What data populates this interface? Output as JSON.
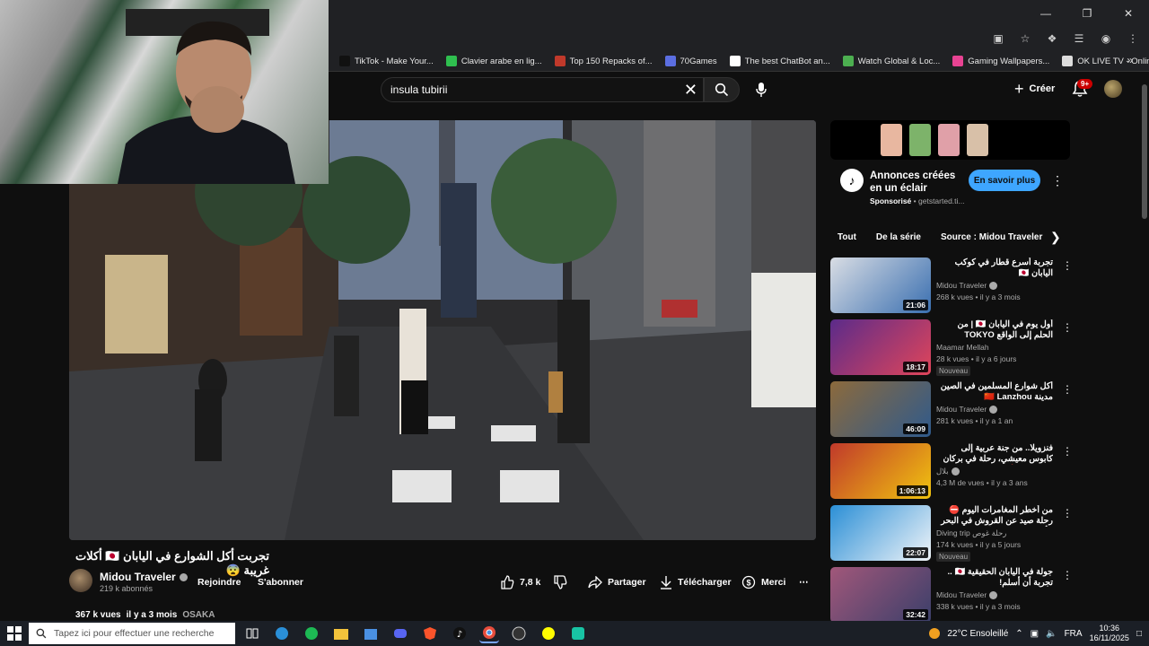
{
  "bookmarks": [
    {
      "label": "TikTok - Make Your...",
      "color": "#111111"
    },
    {
      "label": "Clavier arabe en lig...",
      "color": "#2fbf4f"
    },
    {
      "label": "Top 150 Repacks of...",
      "color": "#c0392b"
    },
    {
      "label": "70Games",
      "color": "#5b6ee1"
    },
    {
      "label": "The best ChatBot an...",
      "color": "#ffffff"
    },
    {
      "label": "Watch Global & Loc...",
      "color": "#4caf50"
    },
    {
      "label": "Gaming Wallpapers...",
      "color": "#e84393"
    },
    {
      "label": "OK LIVE TV - Online...",
      "color": "#dddddd"
    }
  ],
  "header": {
    "search_value": "insula tubirii",
    "create_label": "Créer",
    "notif_count": "9+"
  },
  "video": {
    "title": "تجربت أكل الشوارع في اليابان 🇯🇵 أكلات غريبة 😨",
    "channel": "Midou Traveler",
    "subscribers": "219 k abonnés",
    "join_label": "Rejoindre",
    "subscribe_label": "S'abonner",
    "likes": "7,8 k",
    "share_label": "Partager",
    "download_label": "Télécharger",
    "thanks_label": "Merci",
    "views": "367 k vues",
    "age": "il y a 3 mois",
    "tag": "OSAKA"
  },
  "ad": {
    "title": "Annonces créées en un éclair",
    "sponsored": "Sponsorisé",
    "domain": "getstarted.ti...",
    "cta": "En savoir plus"
  },
  "chips": [
    "Tout",
    "De la série",
    "Source : Midou Traveler"
  ],
  "recommendations": [
    {
      "title": "تجربة أسرع قطار في كوكب اليابان 🇯🇵",
      "channel": "Midou Traveler",
      "verified": true,
      "views": "268 k vues • il y a 3 mois",
      "duration": "21:06",
      "badge": "",
      "colors": [
        "#d9dde4",
        "#3a6fb0"
      ]
    },
    {
      "title": "أول يوم في اليابان 🇯🇵 | من الحلم إلى الواقع TOKYO",
      "channel": "Maamar Mellah",
      "verified": false,
      "views": "28 k vues • il y a 6 jours",
      "duration": "18:17",
      "badge": "Nouveau",
      "colors": [
        "#5b2b8a",
        "#e0455a"
      ]
    },
    {
      "title": "أكل شوارع المسلمين في الصين مدينة 🇨🇳 Lanzhou",
      "channel": "Midou Traveler",
      "verified": true,
      "views": "281 k vues • il y a 1 an",
      "duration": "46:09",
      "badge": "",
      "colors": [
        "#8c6a3c",
        "#2f5a8c"
      ]
    },
    {
      "title": "فنزويلا.. من جنة عربية إلى كابوس معيشي، رحلة في بركان الخطر 🇻🇪🔥",
      "channel": "بلال",
      "verified": true,
      "views": "4,3 M de vues • il y a 3 ans",
      "duration": "1:06:13",
      "badge": "",
      "colors": [
        "#c0392b",
        "#f1c40f"
      ]
    },
    {
      "title": "من أخطر المغامرات اليوم ⛔ رحلة صيد عن القروش في البحر الأبيض المتوسط 🦈",
      "channel": "Diving trip رحلة غوص",
      "verified": false,
      "views": "174 k vues • il y a 5 jours",
      "duration": "22:07",
      "badge": "Nouveau",
      "colors": [
        "#2b8fd6",
        "#f0f4f8"
      ]
    },
    {
      "title": "جولة في اليابان الحقيقية 🇯🇵 .. تجربة أن أسلم!",
      "channel": "Midou Traveler",
      "verified": true,
      "views": "338 k vues • il y a 3 mois",
      "duration": "32:42",
      "badge": "",
      "colors": [
        "#a1577a",
        "#3b3f6a"
      ]
    }
  ],
  "taskbar": {
    "search_placeholder": "Tapez ici pour effectuer une recherche",
    "weather": "22°C Ensoleillé",
    "lang": "FRA",
    "time": "10:36",
    "date": "16/11/2025"
  }
}
